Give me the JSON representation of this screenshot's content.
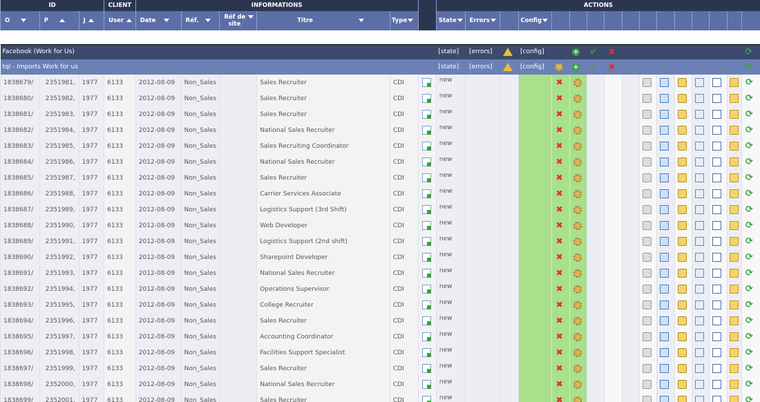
{
  "header": {
    "groups": {
      "id": "ID",
      "client": "CLIENT",
      "informations": "INFORMATIONS",
      "actions": "ACTIONS"
    },
    "cols": {
      "o": "O",
      "p": "P",
      "j": "J",
      "user": "User",
      "date": "Date",
      "ref": "Réf.",
      "ref_site_1": "Réf de",
      "ref_site_2": "site",
      "titre": "Titre",
      "type": "Type",
      "state": "State",
      "errors": "Errors",
      "config": "Config"
    }
  },
  "group1": {
    "label": "Facebook (Work for Us)",
    "state": "[state]",
    "errors": "[errors]",
    "config": "[config]"
  },
  "group2": {
    "label": "tql    -    Imports Work for us",
    "state": "[state]",
    "errors": "[errors]",
    "config": "[config]"
  },
  "rows": [
    {
      "o": "1838679/",
      "p": "2351981,",
      "j": "1977",
      "user": "6133",
      "date": "2012-08-09",
      "ref": "Non_Sales",
      "titre": "Sales Recruiter",
      "type": "CDI",
      "state": "new"
    },
    {
      "o": "1838680/",
      "p": "2351982,",
      "j": "1977",
      "user": "6133",
      "date": "2012-08-09",
      "ref": "Non_Sales",
      "titre": "Sales Recruiter",
      "type": "CDI",
      "state": "new"
    },
    {
      "o": "1838681/",
      "p": "2351983,",
      "j": "1977",
      "user": "6133",
      "date": "2012-08-09",
      "ref": "Non_Sales",
      "titre": "Sales Recruiter",
      "type": "CDI",
      "state": "new"
    },
    {
      "o": "1838682/",
      "p": "2351984,",
      "j": "1977",
      "user": "6133",
      "date": "2012-08-09",
      "ref": "Non_Sales",
      "titre": "National Sales Recruiter",
      "type": "CDI",
      "state": "new"
    },
    {
      "o": "1838683/",
      "p": "2351985,",
      "j": "1977",
      "user": "6133",
      "date": "2012-08-09",
      "ref": "Non_Sales",
      "titre": "Sales Recruiting Coordinator",
      "type": "CDI",
      "state": "new"
    },
    {
      "o": "1838684/",
      "p": "2351986,",
      "j": "1977",
      "user": "6133",
      "date": "2012-08-09",
      "ref": "Non_Sales",
      "titre": "National Sales Recruiter",
      "type": "CDI",
      "state": "new"
    },
    {
      "o": "1838685/",
      "p": "2351987,",
      "j": "1977",
      "user": "6133",
      "date": "2012-08-09",
      "ref": "Non_Sales",
      "titre": "Sales Recruiter",
      "type": "CDI",
      "state": "new"
    },
    {
      "o": "1838686/",
      "p": "2351988,",
      "j": "1977",
      "user": "6133",
      "date": "2012-08-09",
      "ref": "Non_Sales",
      "titre": "Carrier Services Associate",
      "type": "CDI",
      "state": "new"
    },
    {
      "o": "1838687/",
      "p": "2351989,",
      "j": "1977",
      "user": "6133",
      "date": "2012-08-09",
      "ref": "Non_Sales",
      "titre": "Logistics Support (3rd Shift)",
      "type": "CDI",
      "state": "new"
    },
    {
      "o": "1838688/",
      "p": "2351990,",
      "j": "1977",
      "user": "6133",
      "date": "2012-08-09",
      "ref": "Non_Sales",
      "titre": "Web Developer",
      "type": "CDI",
      "state": "new"
    },
    {
      "o": "1838689/",
      "p": "2351991,",
      "j": "1977",
      "user": "6133",
      "date": "2012-08-09",
      "ref": "Non_Sales",
      "titre": "Logistics Support (2nd shift)",
      "type": "CDI",
      "state": "new"
    },
    {
      "o": "1838690/",
      "p": "2351992,",
      "j": "1977",
      "user": "6133",
      "date": "2012-08-09",
      "ref": "Non_Sales",
      "titre": "Sharepoint Developer",
      "type": "CDI",
      "state": "new"
    },
    {
      "o": "1838691/",
      "p": "2351993,",
      "j": "1977",
      "user": "6133",
      "date": "2012-08-09",
      "ref": "Non_Sales",
      "titre": "National Sales Recruiter",
      "type": "CDI",
      "state": "new"
    },
    {
      "o": "1838692/",
      "p": "2351994,",
      "j": "1977",
      "user": "6133",
      "date": "2012-08-09",
      "ref": "Non_Sales",
      "titre": "Operations Supervisor",
      "type": "CDI",
      "state": "new"
    },
    {
      "o": "1838693/",
      "p": "2351995,",
      "j": "1977",
      "user": "6133",
      "date": "2012-08-09",
      "ref": "Non_Sales",
      "titre": "College Recruiter",
      "type": "CDI",
      "state": "new"
    },
    {
      "o": "1838694/",
      "p": "2351996,",
      "j": "1977",
      "user": "6133",
      "date": "2012-08-09",
      "ref": "Non_Sales",
      "titre": "Sales Recruiter",
      "type": "CDI",
      "state": "new"
    },
    {
      "o": "1838695/",
      "p": "2351997,",
      "j": "1977",
      "user": "6133",
      "date": "2012-08-09",
      "ref": "Non_Sales",
      "titre": "Accounting Coordinator",
      "type": "CDI",
      "state": "new"
    },
    {
      "o": "1838696/",
      "p": "2351998,",
      "j": "1977",
      "user": "6133",
      "date": "2012-08-09",
      "ref": "Non_Sales",
      "titre": "Facilities Support Specialist",
      "type": "CDI",
      "state": "new"
    },
    {
      "o": "1838697/",
      "p": "2351999,",
      "j": "1977",
      "user": "6133",
      "date": "2012-08-09",
      "ref": "Non_Sales",
      "titre": "Sales Recruiter",
      "type": "CDI",
      "state": "new"
    },
    {
      "o": "1838698/",
      "p": "2352000,",
      "j": "1977",
      "user": "6133",
      "date": "2012-08-09",
      "ref": "Non_Sales",
      "titre": "National Sales Recruiter",
      "type": "CDI",
      "state": "new"
    },
    {
      "o": "1838699/",
      "p": "2352001,",
      "j": "1977",
      "user": "6133",
      "date": "2012-08-09",
      "ref": "Non_Sales",
      "titre": "Sales Recruiter",
      "type": "CDI",
      "state": "new"
    }
  ],
  "icons": {
    "preview": "document-go-icon",
    "delete": "red-x-icon",
    "config": "gear-icon",
    "lock": "lock-icon",
    "sheet": "sheet-icon",
    "star": "star-edit-icon",
    "dbox": "dialog-icon",
    "card": "card-icon",
    "fold": "folder-go-icon",
    "refresh": "refresh-icon",
    "add": "plus-icon",
    "check": "check-icon",
    "warning": "warning-icon"
  }
}
